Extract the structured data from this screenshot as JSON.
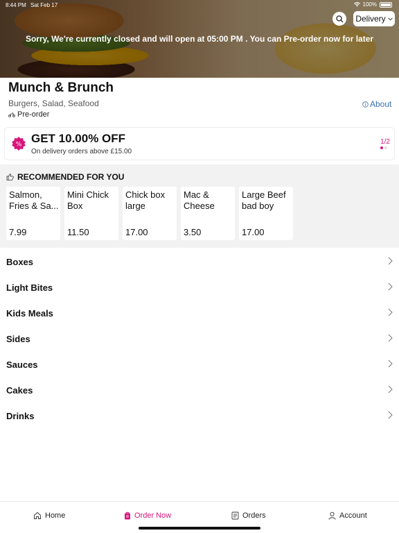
{
  "status_bar": {
    "time": "8:44 PM",
    "date": "Sat Feb 17",
    "battery": "100%"
  },
  "header": {
    "delivery_mode": "Delivery",
    "closed_message": "Sorry, We're currently closed and will open at 05:00 PM . You can Pre-order now for later"
  },
  "restaurant": {
    "name": "Munch & Brunch",
    "cuisine": "Burgers, Salad, Seafood",
    "about_label": "About",
    "preorder_label": "Pre-order"
  },
  "offer": {
    "title": "GET 10.00% OFF",
    "subtitle": "On delivery orders above £15.00",
    "page_indicator": "1/2",
    "accent_color": "#d6157a"
  },
  "recommended": {
    "heading": "RECOMMENDED FOR YOU",
    "items": [
      {
        "name": "Salmon, Fries & Sa...",
        "price": "7.99"
      },
      {
        "name": "Mini Chick Box",
        "price": "11.50"
      },
      {
        "name": "Chick box large",
        "price": "17.00"
      },
      {
        "name": "Mac & Cheese",
        "price": "3.50"
      },
      {
        "name": "Large Beef bad boy",
        "price": "17.00"
      }
    ]
  },
  "categories": [
    {
      "label": "Boxes"
    },
    {
      "label": "Light Bites"
    },
    {
      "label": "Kids Meals"
    },
    {
      "label": "Sides"
    },
    {
      "label": "Sauces"
    },
    {
      "label": "Cakes"
    },
    {
      "label": "Drinks"
    }
  ],
  "nav": {
    "home": "Home",
    "order_now": "Order Now",
    "orders": "Orders",
    "account": "Account"
  }
}
